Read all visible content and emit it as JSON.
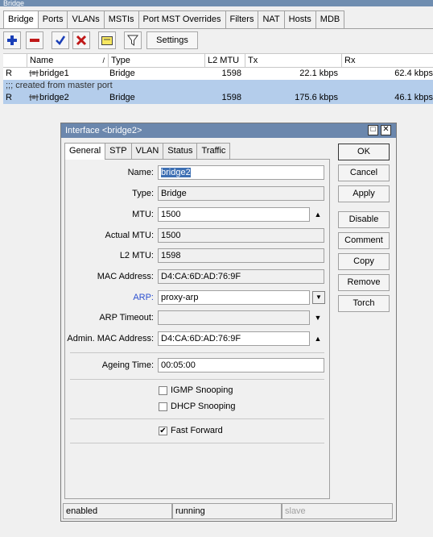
{
  "window": {
    "title": "Bridge"
  },
  "tabs": [
    "Bridge",
    "Ports",
    "VLANs",
    "MSTIs",
    "Port MST Overrides",
    "Filters",
    "NAT",
    "Hosts",
    "MDB"
  ],
  "toolbar": {
    "settings_label": "Settings"
  },
  "table": {
    "columns": [
      "Name",
      "Type",
      "L2 MTU",
      "Tx",
      "Rx"
    ],
    "rows": [
      {
        "flag": "R",
        "name": "bridge1",
        "type": "Bridge",
        "l2mtu": "1598",
        "tx": "22.1 kbps",
        "rx": "62.4 kbps"
      },
      {
        "comment": ";;; created from master port"
      },
      {
        "flag": "R",
        "name": "bridge2",
        "type": "Bridge",
        "l2mtu": "1598",
        "tx": "175.6 kbps",
        "rx": "46.1 kbps"
      }
    ]
  },
  "dialog": {
    "title": "Interface <bridge2>",
    "tabs": [
      "General",
      "STP",
      "VLAN",
      "Status",
      "Traffic"
    ],
    "fields": {
      "name": {
        "label": "Name:",
        "value": "bridge2"
      },
      "type": {
        "label": "Type:",
        "value": "Bridge"
      },
      "mtu": {
        "label": "MTU:",
        "value": "1500"
      },
      "actual_mtu": {
        "label": "Actual MTU:",
        "value": "1500"
      },
      "l2mtu": {
        "label": "L2 MTU:",
        "value": "1598"
      },
      "mac": {
        "label": "MAC Address:",
        "value": "D4:CA:6D:AD:76:9F"
      },
      "arp": {
        "label": "ARP:",
        "value": "proxy-arp"
      },
      "arp_timeout": {
        "label": "ARP Timeout:",
        "value": ""
      },
      "admin_mac": {
        "label": "Admin. MAC Address:",
        "value": "D4:CA:6D:AD:76:9F"
      },
      "ageing": {
        "label": "Ageing Time:",
        "value": "00:05:00"
      }
    },
    "checkboxes": {
      "igmp": {
        "label": "IGMP Snooping",
        "checked": false
      },
      "dhcp": {
        "label": "DHCP Snooping",
        "checked": false
      },
      "fast_forward": {
        "label": "Fast Forward",
        "checked": true
      }
    },
    "buttons": [
      "OK",
      "Cancel",
      "Apply",
      "Disable",
      "Comment",
      "Copy",
      "Remove",
      "Torch"
    ],
    "status": [
      "enabled",
      "running",
      "slave"
    ]
  },
  "colors": {
    "selection": "#b4cdeb",
    "titlebar": "#6b87ad",
    "link_label": "#2b4fd0"
  }
}
